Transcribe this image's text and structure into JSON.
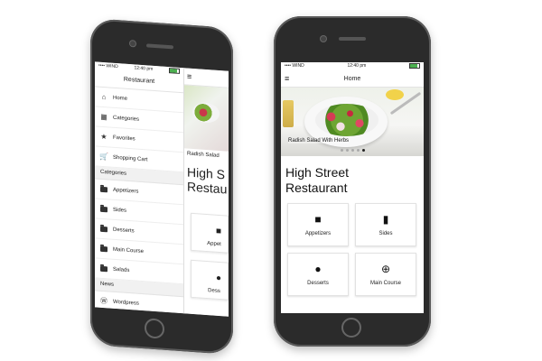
{
  "status": {
    "carrier": "•••• WIND",
    "time": "12:40 pm"
  },
  "left": {
    "drawer_title": "Restaurant",
    "menu": [
      {
        "icon": "home-icon",
        "label": "Home"
      },
      {
        "icon": "grid-icon",
        "label": "Categories"
      },
      {
        "icon": "star-icon",
        "label": "Favorites"
      },
      {
        "icon": "cart-icon",
        "label": "Shopping Cart"
      }
    ],
    "categories_header": "Categories",
    "categories": [
      {
        "icon": "folder-icon",
        "label": "Appetizers"
      },
      {
        "icon": "folder-icon",
        "label": "Sides"
      },
      {
        "icon": "folder-icon",
        "label": "Desserts"
      },
      {
        "icon": "folder-icon",
        "label": "Main Course"
      },
      {
        "icon": "folder-icon",
        "label": "Salads"
      }
    ],
    "news_header": "News",
    "news": [
      {
        "icon": "wordpress-icon",
        "label": "Wordpress"
      }
    ],
    "peek": {
      "caption": "Radish Salad",
      "title": "High S\nRestau",
      "tile1": "Appet",
      "tile2": "Dess"
    }
  },
  "right": {
    "header_title": "Home",
    "hero_caption": "Radish Salad With Herbs",
    "carousel_total": 5,
    "carousel_active": 5,
    "restaurant_name_line1": "High Street",
    "restaurant_name_line2": "Restaurant",
    "tiles": [
      {
        "icon": "square-icon",
        "label": "Appetizers"
      },
      {
        "icon": "can-icon",
        "label": "Sides"
      },
      {
        "icon": "bulb-icon",
        "label": "Desserts"
      },
      {
        "icon": "lifebuoy-icon",
        "label": "Main Course"
      }
    ]
  }
}
